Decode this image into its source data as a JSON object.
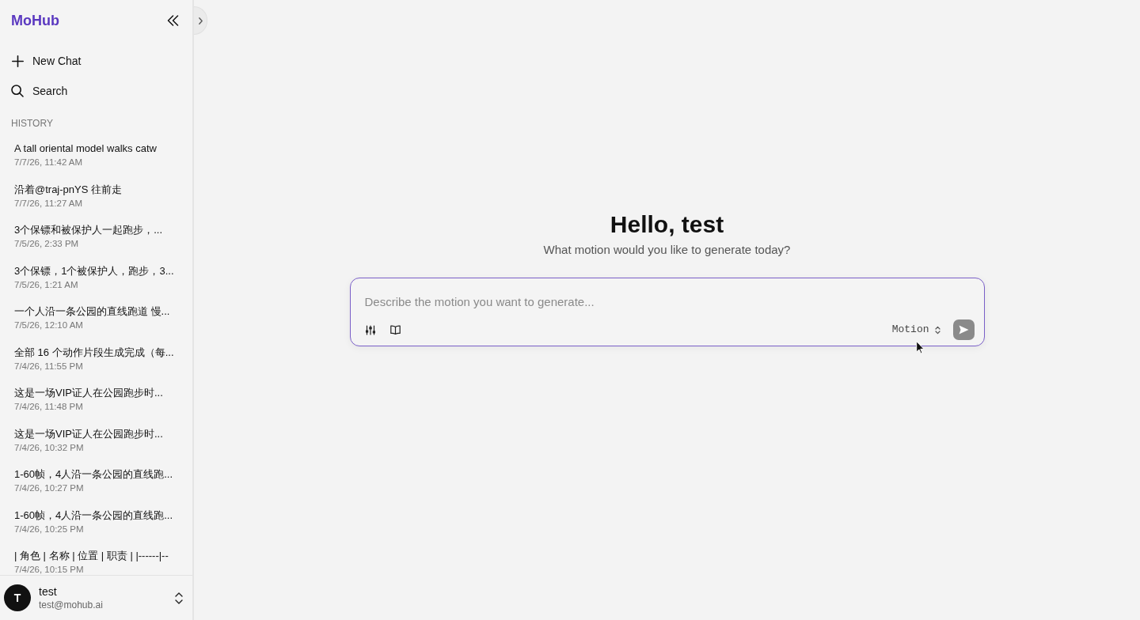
{
  "sidebar": {
    "logo": "MoHub",
    "actions": [
      {
        "kind": "new",
        "label": "New Chat"
      },
      {
        "kind": "search",
        "label": "Search"
      }
    ],
    "history_label": "HISTORY",
    "history": [
      {
        "title": "A tall oriental model walks catw",
        "time": "7/7/26, 11:42 AM",
        "selected": false
      },
      {
        "title": "沿着@traj-pnYS 往前走",
        "time": "7/7/26, 11:27 AM",
        "selected": false
      },
      {
        "title": "3个保镖和被保护人一起跑步，...",
        "time": "7/5/26, 2:33 PM",
        "selected": false
      },
      {
        "title": "3个保镖，1个被保护人，跑步，3...",
        "time": "7/5/26, 1:21 AM",
        "selected": false
      },
      {
        "title": "一个人沿一条公园的直线跑道 慢...",
        "time": "7/5/26, 12:10 AM",
        "selected": false
      },
      {
        "title": "全部 16 个动作片段生成完成（每...",
        "time": "7/4/26, 11:55 PM",
        "selected": false
      },
      {
        "title": "这是一场VIP证人在公园跑步时...",
        "time": "7/4/26, 11:48 PM",
        "selected": false
      },
      {
        "title": "这是一场VIP证人在公园跑步时...",
        "time": "7/4/26, 10:32 PM",
        "selected": false
      },
      {
        "title": "1-60帧，4人沿一条公园的直线跑...",
        "time": "7/4/26, 10:27 PM",
        "selected": false
      },
      {
        "title": "1-60帧，4人沿一条公园的直线跑...",
        "time": "7/4/26, 10:25 PM",
        "selected": false
      },
      {
        "title": "| 角色 | 名称 | 位置 | 职责 | |------|--",
        "time": "7/4/26, 10:15 PM",
        "selected": false
      }
    ],
    "user": {
      "initial": "T",
      "name": "test",
      "email": "test@mohub.ai"
    }
  },
  "main": {
    "greeting": "Hello, test",
    "subtitle": "What motion would you like to generate today?",
    "prompt": {
      "placeholder": "Describe the motion you want to generate...",
      "mode": "Motion",
      "send_disabled": true
    }
  }
}
